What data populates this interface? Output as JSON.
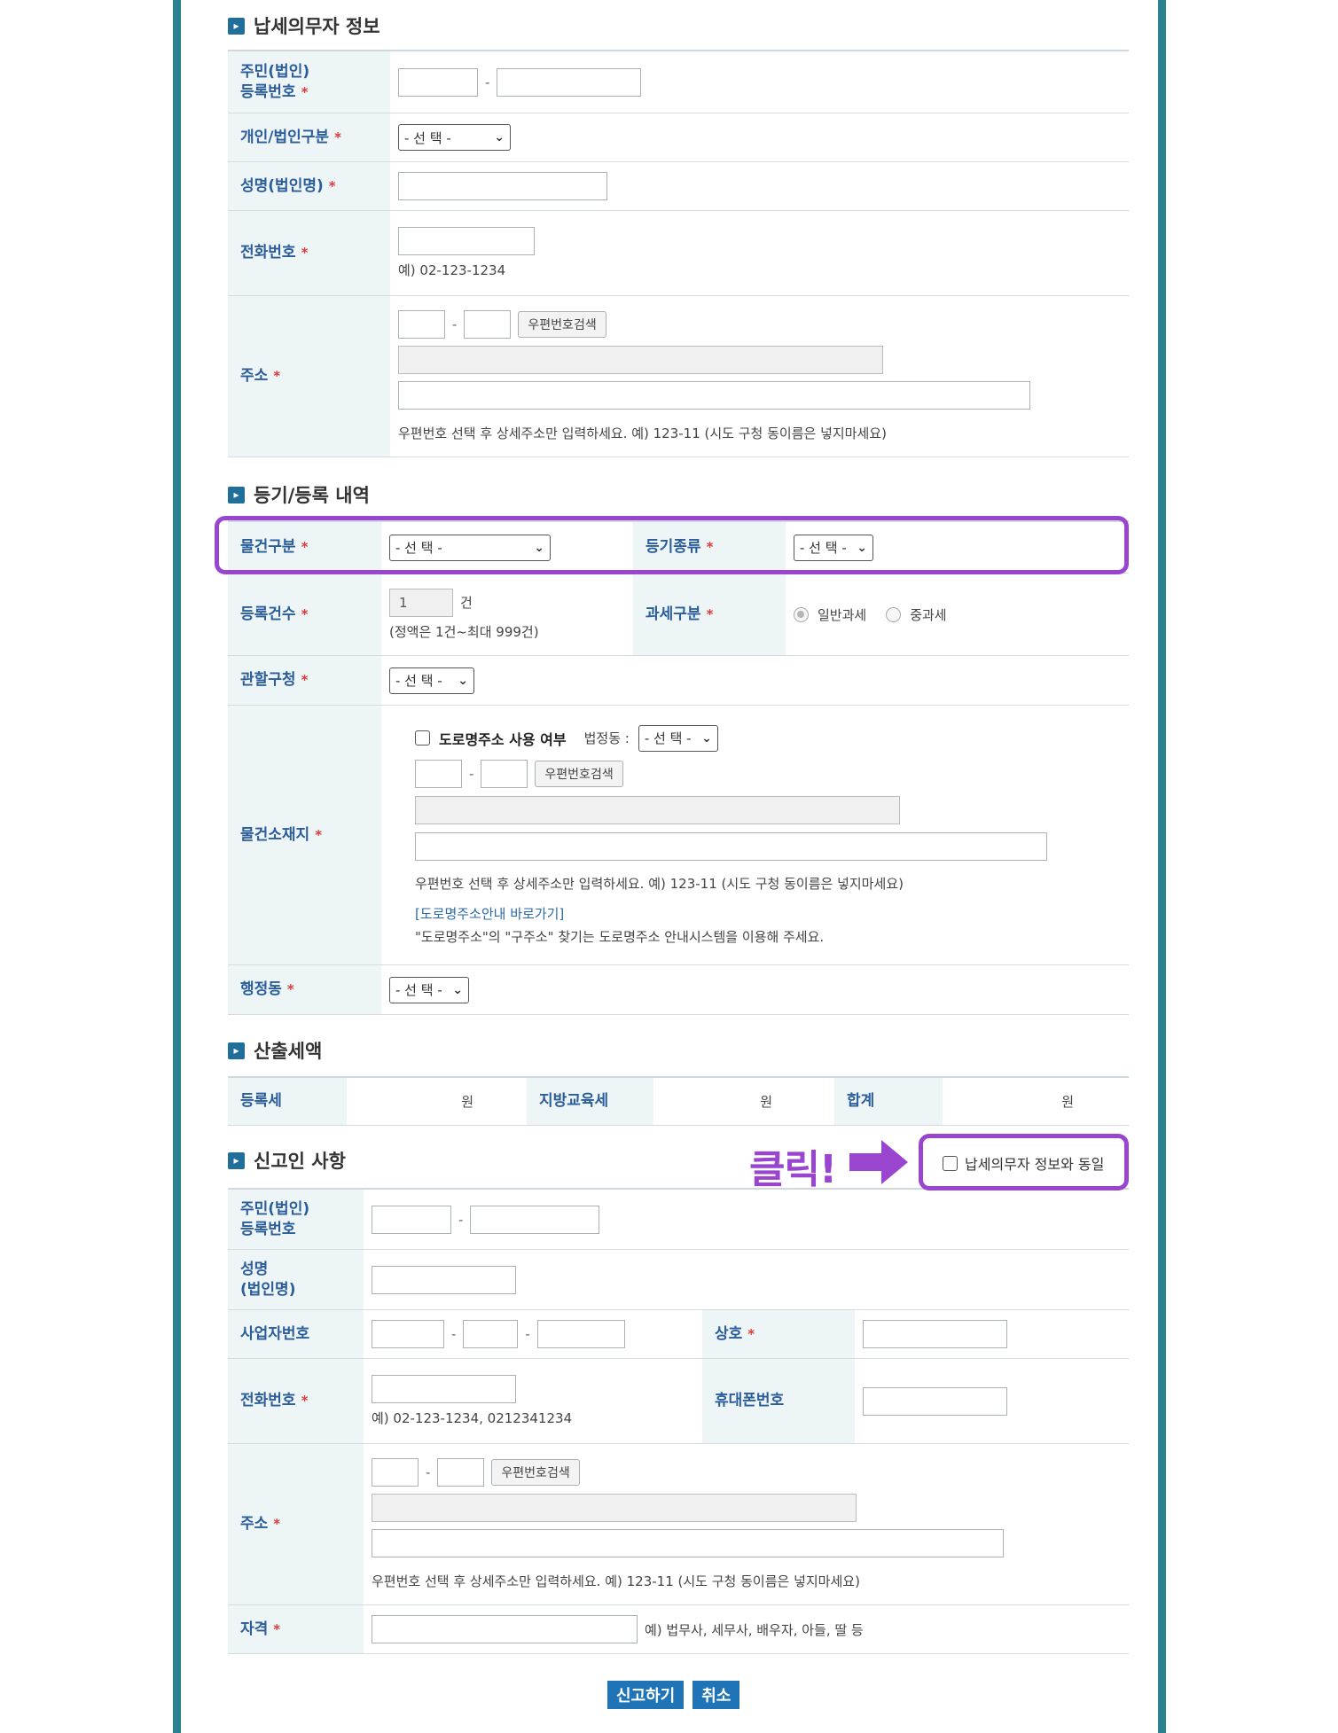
{
  "required_mark": "*",
  "taxpayer": {
    "title": "납세의무자 정보",
    "rrn_label_1": "주민(법인)",
    "rrn_label_2": "등록번호",
    "type_label": "개인/법인구분",
    "type_select": "- 선 택 -",
    "name_label": "성명(법인명)",
    "phone_label": "전화번호",
    "phone_hint": "예) 02-123-1234",
    "address_label": "주소",
    "zip_button": "우편번호검색",
    "address_hint": "우편번호 선택 후 상세주소만 입력하세요. 예) 123-11 (시도 구청 동이름은 넣지마세요)"
  },
  "registration": {
    "title": "등기/등록 내역",
    "item_type_label": "물건구분",
    "item_type_select": "- 선 택 -",
    "reg_kind_label": "등기종류",
    "reg_kind_select": "- 선 택 -",
    "count_label": "등록건수",
    "count_value": "1",
    "count_unit": "건",
    "count_hint": "(정액은 1건~최대 999건)",
    "tax_type_label": "과세구분",
    "tax_general": "일반과세",
    "tax_heavy": "중과세",
    "office_label": "관할구청",
    "office_select": "- 선 택 -",
    "location_label": "물건소재지",
    "road_addr_checkbox": "도로명주소 사용 여부",
    "legal_dong_label": "법정동 :",
    "legal_dong_select": "- 선 택 -",
    "zip_button": "우편번호검색",
    "address_hint": "우편번호 선택 후 상세주소만 입력하세요. 예) 123-11 (시도 구청 동이름은 넣지마세요)",
    "road_link": "[도로명주소안내 바로가기]",
    "road_hint": "\"도로명주소\"의 \"구주소\" 찾기는 도로명주소 안내시스템을 이용해 주세요.",
    "admin_dong_label": "행정동",
    "admin_dong_select": "- 선 택 -"
  },
  "tax": {
    "title": "산출세액",
    "reg_tax_label": "등록세",
    "reg_tax_unit": "원",
    "edu_tax_label": "지방교육세",
    "edu_tax_unit": "원",
    "total_label": "합계",
    "total_unit": "원"
  },
  "reporter": {
    "title": "신고인 사항",
    "click_annotation": "클릭!",
    "same_as_checkbox": "납세의무자 정보와 동일",
    "rrn_label_1": "주민(법인)",
    "rrn_label_2": "등록번호",
    "name_label_1": "성명",
    "name_label_2": "(법인명)",
    "biz_no_label": "사업자번호",
    "company_label": "상호",
    "phone_label": "전화번호",
    "phone_hint": "예) 02-123-1234, 0212341234",
    "mobile_label": "휴대폰번호",
    "address_label": "주소",
    "zip_button": "우편번호검색",
    "address_hint": "우편번호 선택 후 상세주소만 입력하세요. 예) 123-11 (시도 구청 동이름은 넣지마세요)",
    "qual_label": "자격",
    "qual_hint": "예) 법무사, 세무사, 배우자, 아들, 딸 등"
  },
  "actions": {
    "submit": "신고하기",
    "cancel": "취소"
  },
  "colors": {
    "frame": "#2a8190",
    "label_bg": "#eef5f7",
    "label_text": "#2b5d9a",
    "highlight": "#9a45d0",
    "button": "#1f73b7"
  }
}
